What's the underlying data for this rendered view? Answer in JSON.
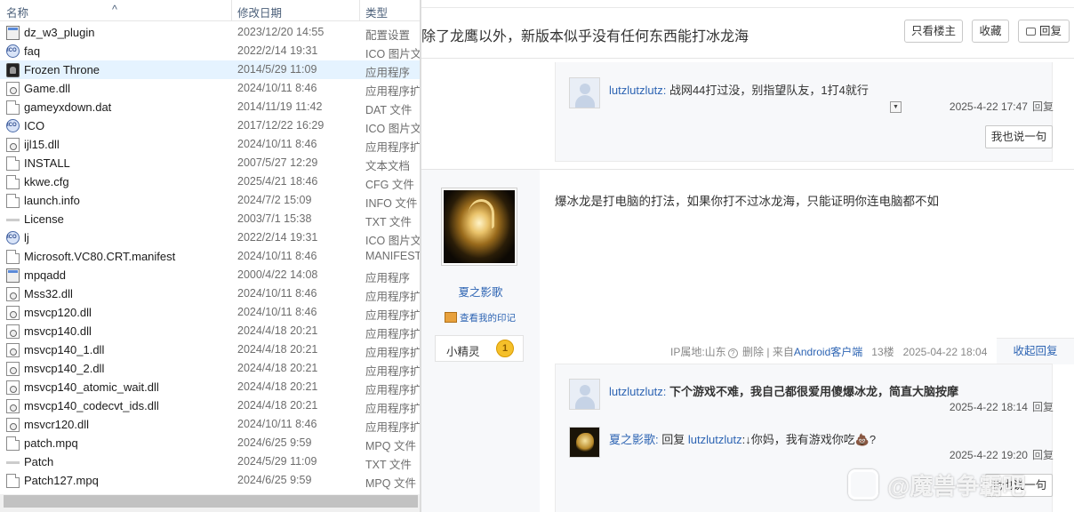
{
  "explorer": {
    "columns": {
      "name": "名称",
      "date": "修改日期",
      "type": "类型"
    },
    "files": [
      {
        "name": "dz_w3_plugin",
        "date": "2023/12/20 14:55",
        "type": "配置设置",
        "icon": "settings-file-icon"
      },
      {
        "name": "faq",
        "date": "2022/2/14 19:31",
        "type": "ICO 图片文",
        "icon": "ico-file-icon"
      },
      {
        "name": "Frozen Throne",
        "date": "2014/5/29 11:09",
        "type": "应用程序",
        "icon": "game-app-icon",
        "selected": true
      },
      {
        "name": "Game.dll",
        "date": "2024/10/11 8:46",
        "type": "应用程序扩",
        "icon": "dll-file-icon"
      },
      {
        "name": "gameyxdown.dat",
        "date": "2014/11/19 11:42",
        "type": "DAT 文件",
        "icon": "generic-file-icon"
      },
      {
        "name": "ICO",
        "date": "2017/12/22 16:29",
        "type": "ICO 图片文",
        "icon": "ico-file-icon"
      },
      {
        "name": "ijl15.dll",
        "date": "2024/10/11 8:46",
        "type": "应用程序扩",
        "icon": "dll-file-icon"
      },
      {
        "name": "INSTALL",
        "date": "2007/5/27 12:29",
        "type": "文本文档",
        "icon": "text-file-icon"
      },
      {
        "name": "kkwe.cfg",
        "date": "2025/4/21 18:46",
        "type": "CFG 文件",
        "icon": "generic-file-icon"
      },
      {
        "name": "launch.info",
        "date": "2024/7/2 15:09",
        "type": "INFO 文件",
        "icon": "generic-file-icon"
      },
      {
        "name": "License",
        "date": "2003/7/1 15:38",
        "type": "TXT 文件",
        "icon": "txt-file-icon"
      },
      {
        "name": "lj",
        "date": "2022/2/14 19:31",
        "type": "ICO 图片文",
        "icon": "ico-file-icon"
      },
      {
        "name": "Microsoft.VC80.CRT.manifest",
        "date": "2024/10/11 8:46",
        "type": "MANIFEST",
        "icon": "generic-file-icon"
      },
      {
        "name": "mpqadd",
        "date": "2000/4/22 14:08",
        "type": "应用程序",
        "icon": "app-icon"
      },
      {
        "name": "Mss32.dll",
        "date": "2024/10/11 8:46",
        "type": "应用程序扩",
        "icon": "dll-file-icon"
      },
      {
        "name": "msvcp120.dll",
        "date": "2024/10/11 8:46",
        "type": "应用程序扩",
        "icon": "dll-file-icon"
      },
      {
        "name": "msvcp140.dll",
        "date": "2024/4/18 20:21",
        "type": "应用程序扩",
        "icon": "dll-file-icon"
      },
      {
        "name": "msvcp140_1.dll",
        "date": "2024/4/18 20:21",
        "type": "应用程序扩",
        "icon": "dll-file-icon"
      },
      {
        "name": "msvcp140_2.dll",
        "date": "2024/4/18 20:21",
        "type": "应用程序扩",
        "icon": "dll-file-icon"
      },
      {
        "name": "msvcp140_atomic_wait.dll",
        "date": "2024/4/18 20:21",
        "type": "应用程序扩",
        "icon": "dll-file-icon"
      },
      {
        "name": "msvcp140_codecvt_ids.dll",
        "date": "2024/4/18 20:21",
        "type": "应用程序扩",
        "icon": "dll-file-icon"
      },
      {
        "name": "msvcr120.dll",
        "date": "2024/10/11 8:46",
        "type": "应用程序扩",
        "icon": "dll-file-icon"
      },
      {
        "name": "patch.mpq",
        "date": "2024/6/25 9:59",
        "type": "MPQ 文件",
        "icon": "generic-file-icon"
      },
      {
        "name": "Patch",
        "date": "2024/5/29 11:09",
        "type": "TXT 文件",
        "icon": "txt-file-icon"
      },
      {
        "name": "Patch127.mpq",
        "date": "2024/6/25 9:59",
        "type": "MPQ 文件",
        "icon": "generic-file-icon"
      }
    ]
  },
  "forum": {
    "thread_title": "除了龙鹰以外，新版本似乎没有任何东西能打冰龙海",
    "buttons": {
      "only_op": "只看楼主",
      "favorite": "收藏",
      "reply": "回复"
    },
    "top_reply": {
      "user": "lutzlutzlutz:",
      "text": "战网44打过没，别指望队友，1打4就行",
      "time": "2025-4-22 17:47",
      "reply_link": "回复",
      "say_button": "我也说一句"
    },
    "floor": {
      "username": "夏之影歌",
      "mark_link": "查看我的印记",
      "badge_name": "小精灵",
      "badge_level": "1",
      "content": "爆冰龙是打电脑的打法，如果你打不过冰龙海，只能证明你连电脑都不如",
      "ip": "IP属地:山东",
      "delete": "删除",
      "from_prefix": "来自",
      "client": "Android客户端",
      "floor_no": "13楼",
      "post_time": "2025-04-22 18:04",
      "collapse": "收起回复",
      "replies": [
        {
          "user": "lutzlutzlutz:",
          "text": "下个游戏不难，我自己都很爱用傻爆冰龙，简直大脑按摩",
          "time": "2025-4-22 18:14",
          "reply_link": "回复"
        },
        {
          "user": "夏之影歌:",
          "prefix": "回复",
          "target": "lutzlutzlutz",
          "text": ":↓你妈，我有游戏你吃💩?",
          "time": "2025-4-22 19:20",
          "reply_link": "回复"
        }
      ],
      "say_button": "我也说一句"
    },
    "watermark": "@魔兽争霸吧"
  }
}
